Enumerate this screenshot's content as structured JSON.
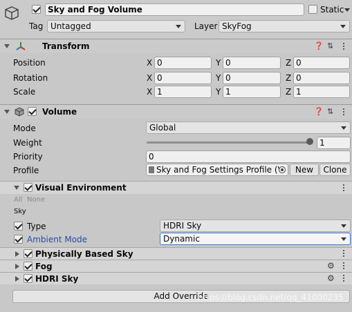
{
  "header": {
    "object_name": "Sky and Fog Volume",
    "static_label": "Static",
    "tag_label": "Tag",
    "tag_value": "Untagged",
    "layer_label": "Layer",
    "layer_value": "SkyFog"
  },
  "transform": {
    "title": "Transform",
    "rows": [
      {
        "label": "Position",
        "x": "0",
        "y": "0",
        "z": "0"
      },
      {
        "label": "Rotation",
        "x": "0",
        "y": "0",
        "z": "0"
      },
      {
        "label": "Scale",
        "x": "1",
        "y": "1",
        "z": "1"
      }
    ],
    "axis_x": "X",
    "axis_y": "Y",
    "axis_z": "Z"
  },
  "volume": {
    "title": "Volume",
    "mode_label": "Mode",
    "mode_value": "Global",
    "weight_label": "Weight",
    "weight_value": "1",
    "weight_fraction": 1,
    "priority_label": "Priority",
    "priority_value": "0",
    "profile_label": "Profile",
    "profile_value": "Sky and Fog Settings Profile (V",
    "new_button": "New",
    "clone_button": "Clone"
  },
  "visual_environment": {
    "title": "Visual Environment",
    "all_label": "All",
    "none_label": "None",
    "sky_label": "Sky",
    "type_label": "Type",
    "type_value": "HDRI Sky",
    "ambient_label": "Ambient Mode",
    "ambient_value": "Dynamic"
  },
  "overrides": [
    {
      "title": "Physically Based Sky"
    },
    {
      "title": "Fog"
    },
    {
      "title": "HDRI Sky"
    }
  ],
  "add_override_button": "Add Override",
  "watermark": "https://blog.csdn.net/qq_41000235",
  "colors": {
    "background": "#c8c8c8",
    "header": "#cbcbcb",
    "field": "#f0f0f0",
    "link_blue": "#1f4fa8",
    "focus_blue": "#3a78d6"
  }
}
